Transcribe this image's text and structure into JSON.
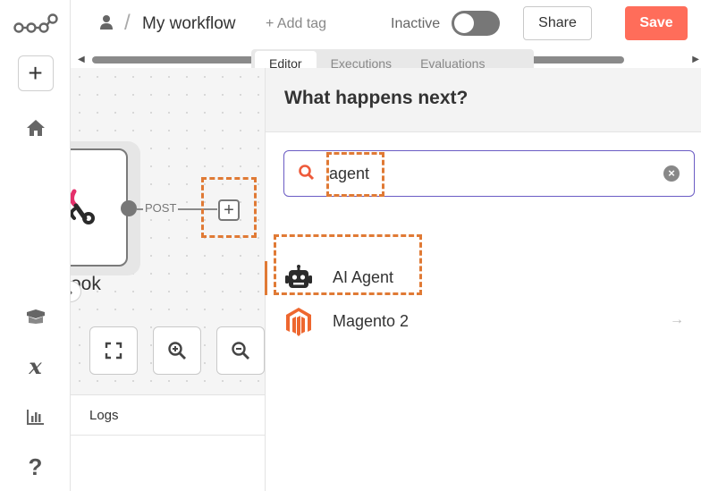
{
  "topbar": {
    "workflow_name": "My workflow",
    "add_tag": "+ Add tag",
    "status_label": "Inactive",
    "active": false,
    "share_label": "Share",
    "save_label": "Save",
    "breadcrumb_separator": "/"
  },
  "rail": {
    "new_label": "+",
    "variables_glyph": "x",
    "help_glyph": "?",
    "icons": [
      "n8n-logo-icon",
      "plus-icon",
      "home-icon",
      "templates-box-icon",
      "variables-icon",
      "insights-chart-icon",
      "help-icon"
    ]
  },
  "tabs": [
    {
      "label": "Editor",
      "active": true
    },
    {
      "label": "Executions",
      "active": false
    },
    {
      "label": "Evaluations",
      "active": false
    }
  ],
  "canvas": {
    "node_label": "ook",
    "connection_label": "POST",
    "plus_glyph": "+"
  },
  "logs": {
    "title": "Logs"
  },
  "panel": {
    "title": "What happens next?",
    "search_value": "agent",
    "results": [
      {
        "label": "AI Agent",
        "icon": "robot-icon"
      },
      {
        "label": "Magento 2",
        "icon": "magento-icon",
        "arrow": "→"
      }
    ]
  },
  "colors": {
    "save": "#ff6d5a",
    "highlight": "#e07a35",
    "search_border": "#6b5cc4",
    "magento": "#ee672f"
  }
}
